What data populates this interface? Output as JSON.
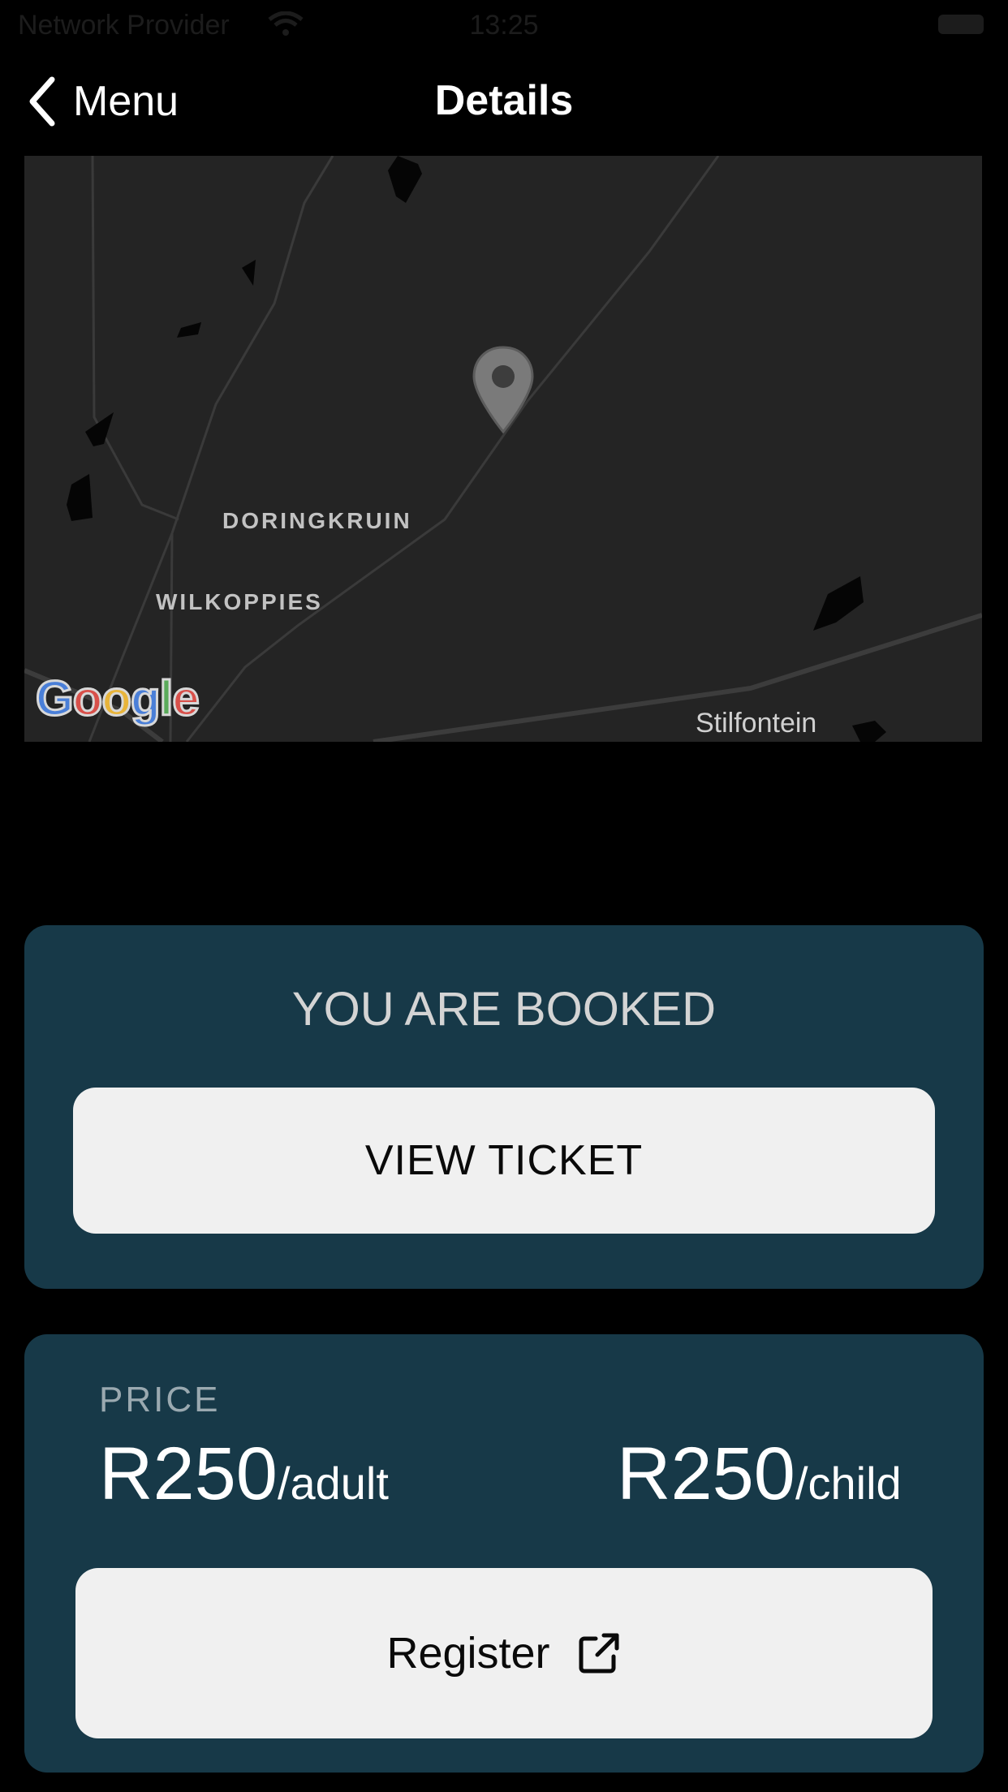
{
  "status_bar": {
    "carrier": "Network Provider",
    "time": "13:25"
  },
  "nav": {
    "back_label": "Menu",
    "title": "Details"
  },
  "map": {
    "labels": {
      "doringkruin": "DORINGKRUIN",
      "wilkoppies": "WILKOPPIES",
      "stilfontein": "Stilfontein"
    },
    "attribution": "Google",
    "colors": {
      "background": "#242424",
      "road": "#3a3a3a",
      "pin": "#7a7a7a"
    }
  },
  "booking": {
    "status_text": "YOU ARE BOOKED",
    "view_ticket_label": "VIEW TICKET"
  },
  "price": {
    "label": "PRICE",
    "adult_amount": "R250",
    "adult_unit": "/adult",
    "child_amount": "R250",
    "child_unit": "/child",
    "register_label": "Register",
    "register_icon": "external-link-icon"
  },
  "colors": {
    "card": "#173948",
    "button": "#f0f0f0",
    "background": "#000000"
  }
}
